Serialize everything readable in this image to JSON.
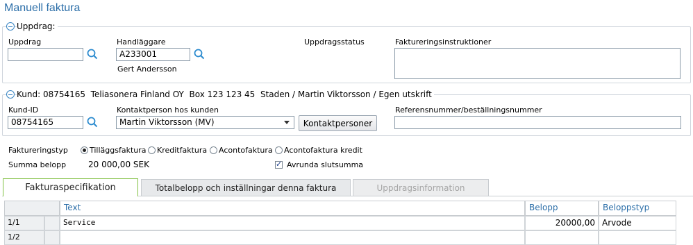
{
  "page_title": "Manuell faktura",
  "uppdrag_section": {
    "header": "Uppdrag:",
    "uppdrag_label": "Uppdrag",
    "uppdrag_value": "",
    "handlaggare_label": "Handläggare",
    "handlaggare_value": "A233001",
    "handlaggare_name": "Gert Andersson",
    "status_label": "Uppdragsstatus",
    "instruktioner_label": "Faktureringsinstruktioner"
  },
  "kund_section": {
    "header": "Kund: 08754165  Teliasonera Finland OY  Box 123 123 45  Staden / Martin Viktorsson / Egen utskrift",
    "kund_id_label": "Kund-ID",
    "kund_id_value": "08754165",
    "kontakt_label": "Kontaktperson hos kunden",
    "kontakt_value": "Martin Viktorsson (MV)",
    "kontakt_button": "Kontaktpersoner",
    "referens_label": "Referensnummer/beställningsnummer",
    "referens_value": ""
  },
  "billing": {
    "typ_label": "Faktureringstyp",
    "options": [
      "Tilläggsfaktura",
      "Kreditfaktura",
      "Acontofaktura",
      "Acontofaktura kredit"
    ],
    "selected": "Tilläggsfaktura",
    "summa_label": "Summa belopp",
    "summa_value": "20 000,00 SEK",
    "avrunda_label": "Avrunda slutsumma",
    "avrunda_checked": true
  },
  "tabs": [
    {
      "label": "Fakturaspecifikation",
      "state": "active"
    },
    {
      "label": "Totalbelopp och inställningar denna faktura",
      "state": "normal"
    },
    {
      "label": "Uppdragsinformation",
      "state": "disabled"
    }
  ],
  "grid": {
    "headers": [
      "Text",
      "Belopp",
      "Beloppstyp"
    ],
    "rows": [
      {
        "num": "1/1",
        "text": "Service",
        "belopp": "20000,00",
        "typ": "Arvode"
      },
      {
        "num": "1/2",
        "text": "",
        "belopp": "",
        "typ": ""
      }
    ]
  },
  "colors": {
    "title": "#2b6ea8",
    "active_tab_border": "#7fbf3f"
  }
}
